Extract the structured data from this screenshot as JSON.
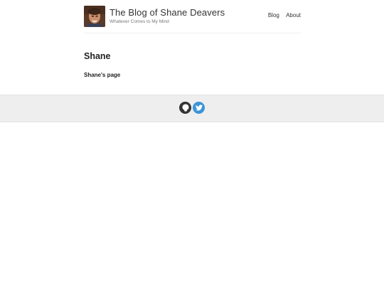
{
  "site": {
    "title": "The Blog of Shane Deavers",
    "description": "Whatever Comes to My Mind"
  },
  "nav": {
    "items": [
      "Blog",
      "About"
    ]
  },
  "page": {
    "title": "Shane",
    "body": "Shane's page"
  },
  "footer": {
    "icons": [
      "github-icon",
      "twitter-icon"
    ],
    "colors": {
      "github": "#333333",
      "twitter": "#3b94d9",
      "background": "#eeeeee"
    }
  }
}
